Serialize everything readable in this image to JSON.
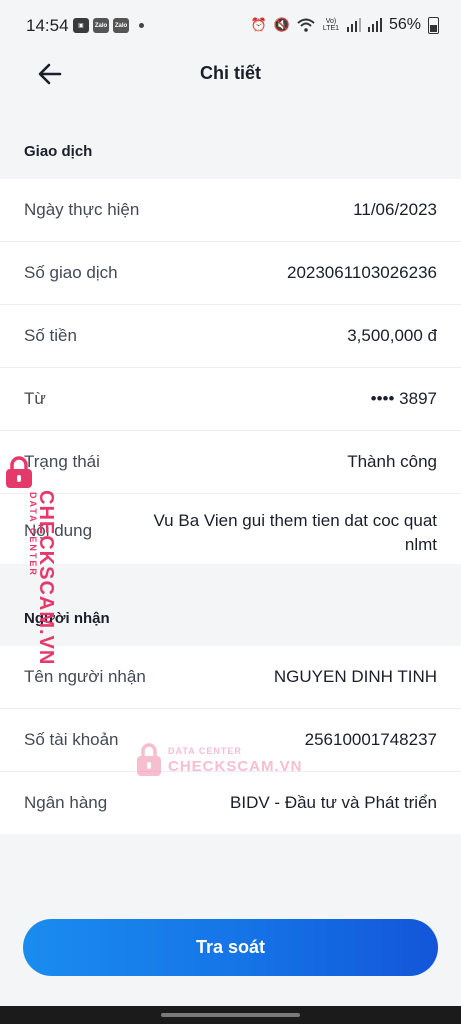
{
  "status_bar": {
    "time": "14:54",
    "app_icon_1": "Zalo",
    "app_icon_2": "Zalo",
    "network": "Vo) LTE1",
    "battery": "56%"
  },
  "header": {
    "title": "Chi tiết"
  },
  "transaction": {
    "section_title": "Giao dịch",
    "rows": [
      {
        "label": "Ngày thực hiện",
        "value": "11/06/2023"
      },
      {
        "label": "Số giao dịch",
        "value": "2023061103026236"
      },
      {
        "label": "Số tiền",
        "value": "3,500,000 đ"
      },
      {
        "label": "Từ",
        "value": "•••• 3897"
      },
      {
        "label": "Trạng thái",
        "value": "Thành công"
      },
      {
        "label": "Nội dung",
        "value": "Vu Ba Vien gui them tien dat coc quat nlmt"
      }
    ]
  },
  "recipient": {
    "section_title": "Người nhận",
    "rows": [
      {
        "label": "Tên người nhận",
        "value": "NGUYEN DINH TINH"
      },
      {
        "label": "Số tài khoản",
        "value": "25610001748237"
      },
      {
        "label": "Ngân hàng",
        "value": "BIDV - Đầu tư và Phát triển"
      }
    ]
  },
  "action": {
    "label": "Tra soát"
  },
  "watermark": {
    "small": "DATA CENTER",
    "big": "CHECKSCAM.VN"
  },
  "colors": {
    "primary": "#1573e6",
    "watermark": "#e6396b"
  }
}
